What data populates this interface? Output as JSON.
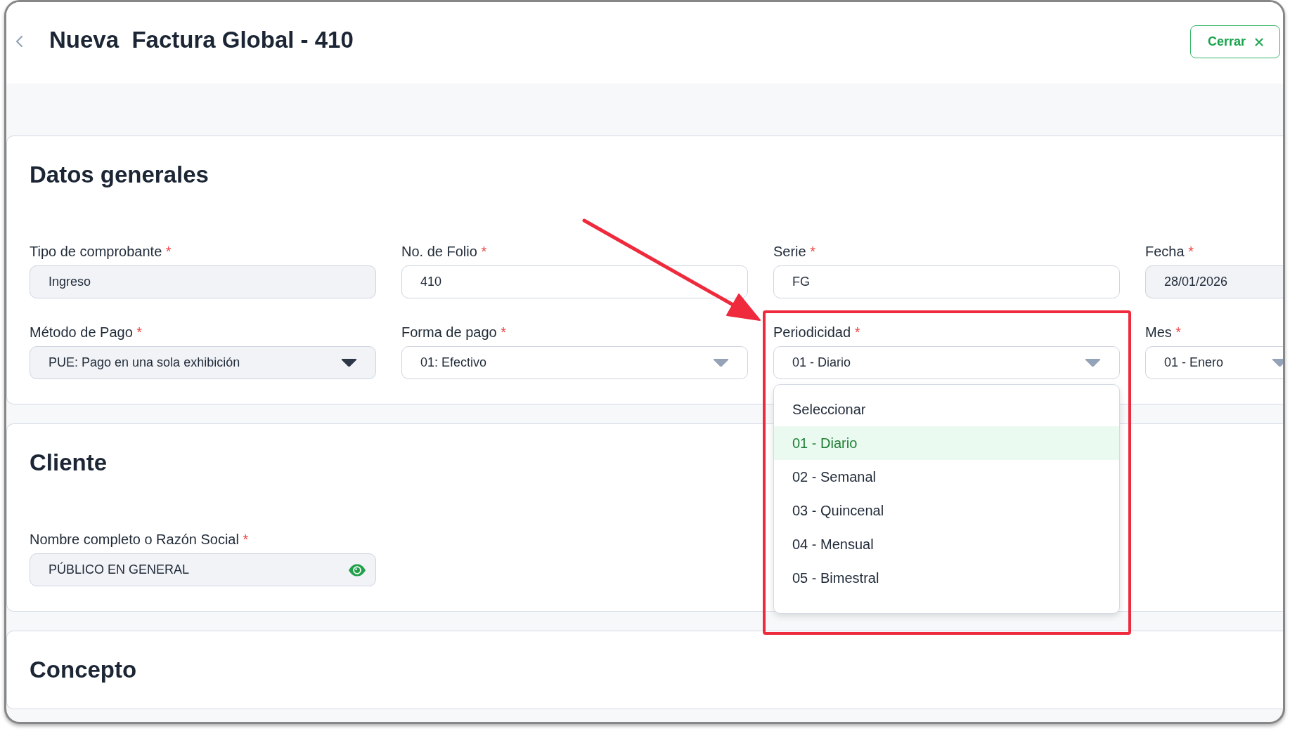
{
  "header": {
    "title": "Nueva  Factura Global - 410",
    "close_button": {
      "label": "Cerrar"
    }
  },
  "sections": [
    {
      "title": "Datos generales",
      "fields": [
        {
          "kind": "input",
          "label": "Tipo de comprobante",
          "required_mark": "*",
          "value": "Ingreso",
          "disabled": true
        },
        {
          "kind": "input",
          "label": "No. de Folio",
          "required_mark": "*",
          "value": "410",
          "disabled": false
        },
        {
          "kind": "input",
          "label": "Serie",
          "required_mark": "*",
          "value": "FG",
          "disabled": false
        },
        {
          "kind": "input",
          "label": "Fecha",
          "required_mark": "*",
          "value": "28/01/2026",
          "disabled": true
        },
        {
          "kind": "select",
          "label": "Método de Pago",
          "required_mark": "*",
          "value": "PUE: Pago en una sola exhibición",
          "disabled": true
        },
        {
          "kind": "select",
          "label": "Forma de pago",
          "required_mark": "*",
          "value": "01: Efectivo",
          "disabled": false
        },
        {
          "kind": "select",
          "label": "Periodicidad",
          "required_mark": "*",
          "value": "01 - Diario",
          "disabled": false,
          "options": [
            {
              "label": "Seleccionar",
              "selected": false
            },
            {
              "label": "01 - Diario",
              "selected": true
            },
            {
              "label": "02 - Semanal",
              "selected": false
            },
            {
              "label": "03 - Quincenal",
              "selected": false
            },
            {
              "label": "04 - Mensual",
              "selected": false
            },
            {
              "label": "05 - Bimestral",
              "selected": false
            }
          ]
        },
        {
          "kind": "select",
          "label": "Mes",
          "required_mark": "*",
          "value": "01 - Enero",
          "disabled": false
        }
      ]
    },
    {
      "title": "Cliente",
      "fields": [
        {
          "kind": "lookup",
          "label": "Nombre completo o Razón Social",
          "required_mark": "*",
          "value": "PÚBLICO EN GENERAL",
          "disabled": true
        }
      ]
    },
    {
      "title": "Concepto"
    }
  ],
  "annotation": {
    "arrow": true,
    "highlight_frame": true
  }
}
